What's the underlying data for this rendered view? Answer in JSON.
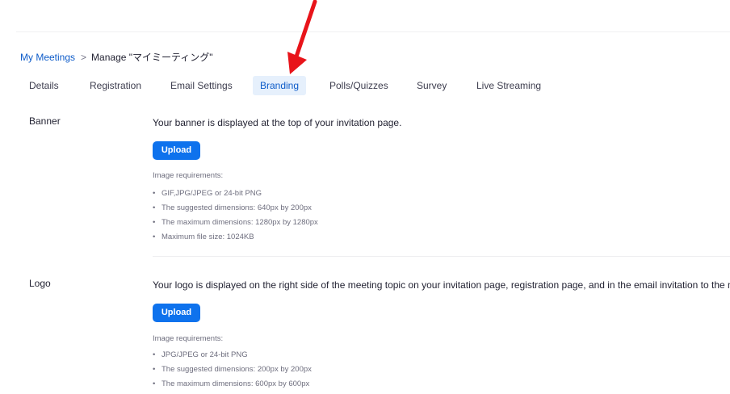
{
  "breadcrumb": {
    "root": "My Meetings",
    "separator": ">",
    "current": "Manage \"マイミーティング\""
  },
  "tabs": [
    {
      "label": "Details",
      "active": false
    },
    {
      "label": "Registration",
      "active": false
    },
    {
      "label": "Email Settings",
      "active": false
    },
    {
      "label": "Branding",
      "active": true
    },
    {
      "label": "Polls/Quizzes",
      "active": false
    },
    {
      "label": "Survey",
      "active": false
    },
    {
      "label": "Live Streaming",
      "active": false
    }
  ],
  "banner": {
    "label": "Banner",
    "description": "Your banner is displayed at the top of your invitation page.",
    "upload_label": "Upload",
    "requirements_title": "Image requirements:",
    "requirements": [
      "GIF,JPG/JPEG or 24-bit PNG",
      "The suggested dimensions: 640px by 200px",
      "The maximum dimensions: 1280px by 1280px",
      "Maximum file size: 1024KB"
    ]
  },
  "logo": {
    "label": "Logo",
    "description": "Your logo is displayed on the right side of the meeting topic on your invitation page, registration page, and in the email invitation to the meeting.",
    "upload_label": "Upload",
    "requirements_title": "Image requirements:",
    "requirements": [
      "JPG/JPEG or 24-bit PNG",
      "The suggested dimensions: 200px by 200px",
      "The maximum dimensions: 600px by 600px"
    ]
  },
  "colors": {
    "accent": "#0e72ed",
    "link": "#0e5cc9",
    "active_tab_bg": "#e6f0fc",
    "arrow": "#e8141a"
  },
  "annotation": {
    "icon": "red-arrow-icon"
  }
}
